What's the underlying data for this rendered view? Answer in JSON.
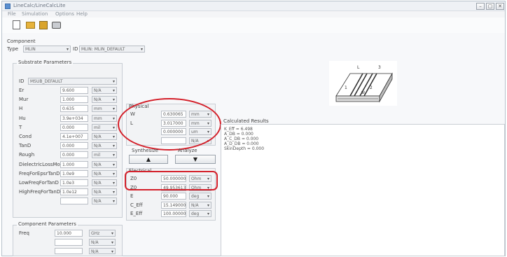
{
  "window": {
    "title": "LineCalc/LineCalcLite",
    "menu": [
      "File",
      "Simulation",
      "Options",
      "Help"
    ],
    "controls": [
      "–",
      "▢",
      "✕"
    ]
  },
  "component": {
    "title": "Component",
    "type_label": "Type",
    "type_value": "MLIN",
    "id_label": "ID",
    "id_value": "MLIN: MLIN_DEFAULT"
  },
  "substrate": {
    "title": "Substrate Parameters",
    "id_label": "ID",
    "id_value": "MSUB_DEFAULT",
    "rows": [
      {
        "name": "Er",
        "value": "9.600",
        "unit": "N/A"
      },
      {
        "name": "Mur",
        "value": "1.000",
        "unit": "N/A"
      },
      {
        "name": "H",
        "value": "0.635",
        "unit": "mm"
      },
      {
        "name": "Hu",
        "value": "3.9e+034",
        "unit": "mm"
      },
      {
        "name": "T",
        "value": "0.000",
        "unit": "mil"
      },
      {
        "name": "Cond",
        "value": "4.1e+007",
        "unit": "N/A"
      },
      {
        "name": "TanD",
        "value": "0.000",
        "unit": "N/A"
      },
      {
        "name": "Rough",
        "value": "0.000",
        "unit": "mil"
      },
      {
        "name": "DielectricLossModel",
        "value": "1.000",
        "unit": "N/A"
      },
      {
        "name": "FreqForEpsrTanD",
        "value": "1.0e9",
        "unit": "N/A"
      },
      {
        "name": "LowFreqForTanD",
        "value": "1.0e3",
        "unit": "N/A"
      },
      {
        "name": "HighFreqForTanD",
        "value": "1.0e12",
        "unit": "N/A"
      },
      {
        "name": "",
        "value": "",
        "unit": "N/A"
      }
    ]
  },
  "component_params": {
    "title": "Component Parameters",
    "freq_label": "Freq",
    "freq_value": "10.000",
    "freq_unit": "GHz",
    "extra_units": [
      "N/A",
      "N/A"
    ]
  },
  "physical": {
    "title": "Physical",
    "rows": [
      {
        "name": "W",
        "value": "0.630065",
        "unit": "mm"
      },
      {
        "name": "L",
        "value": "3.017000",
        "unit": "mm"
      },
      {
        "name": "",
        "value": "0.000000",
        "unit": "um"
      },
      {
        "name": "",
        "value": "",
        "unit": "N/A"
      }
    ]
  },
  "synthesize": {
    "label": "Synthesize",
    "arrow": "▲"
  },
  "analyze": {
    "label": "Analyze",
    "arrow": "▼"
  },
  "electrical": {
    "title": "Electrical",
    "rows": [
      {
        "name": "Z0",
        "value": "50.000000",
        "unit": "Ohm"
      },
      {
        "name": "Z0",
        "value": "49.953613",
        "unit": "Ohm"
      },
      {
        "name": "E",
        "value": "90.000",
        "unit": "deg"
      },
      {
        "name": "C_Eff",
        "value": "15.149000",
        "unit": "N/A"
      },
      {
        "name": "E_Eff",
        "value": "100.000000",
        "unit": "deg"
      }
    ]
  },
  "results": {
    "title": "Calculated Results",
    "lines": [
      "K_Eff = 6.498",
      "A_DB = 0.000",
      "A_C_DB = 0.000",
      "A_D_DB = 0.000",
      "SkinDepth = 0.000"
    ]
  },
  "diagram": {
    "labels": [
      "L",
      "W",
      "3",
      "1",
      "2"
    ]
  }
}
